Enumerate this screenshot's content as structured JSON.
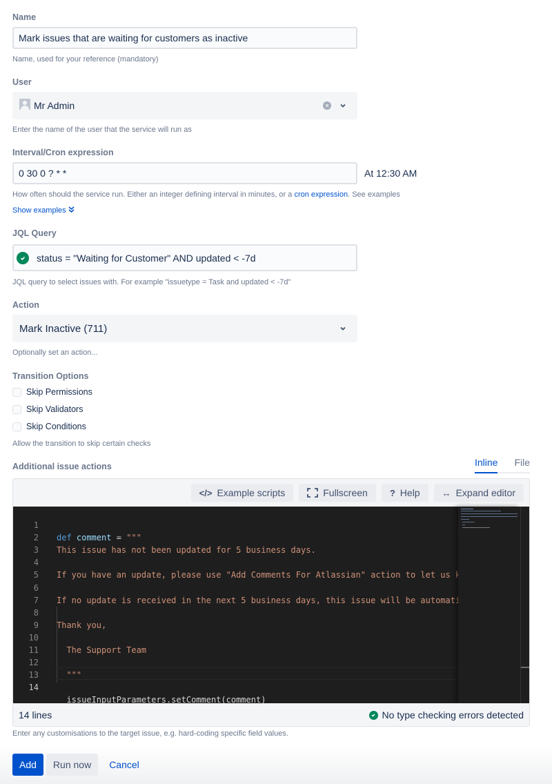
{
  "name": {
    "label": "Name",
    "value": "Mark issues that are waiting for customers as inactive",
    "helper": "Name, used for your reference (mandatory)"
  },
  "user": {
    "label": "User",
    "value": "Mr Admin",
    "helper": "Enter the name of the user that the service will run as"
  },
  "interval": {
    "label": "Interval/Cron expression",
    "value": "0 30 0 ? * *",
    "description": "At 12:30 AM",
    "helper_prefix": "How often should the service run. Either an integer defining interval in minutes, or a ",
    "helper_link": "cron expression",
    "helper_suffix": ". See examples",
    "show_examples": "Show examples"
  },
  "jql": {
    "label": "JQL Query",
    "value": "status = \"Waiting for Customer\" AND updated < -7d",
    "helper": "JQL query to select issues with. For example \"issuetype = Task and updated < -7d\""
  },
  "action": {
    "label": "Action",
    "value": "Mark Inactive (711)",
    "helper": "Optionally set an action..."
  },
  "transition": {
    "label": "Transition Options",
    "options": [
      {
        "label": "Skip Permissions",
        "checked": false
      },
      {
        "label": "Skip Validators",
        "checked": false
      },
      {
        "label": "Skip Conditions",
        "checked": false
      }
    ],
    "helper": "Allow the transition to skip certain checks"
  },
  "additional": {
    "label": "Additional issue actions",
    "tabs": [
      {
        "label": "Inline",
        "active": true
      },
      {
        "label": "File",
        "active": false
      }
    ],
    "toolbar": {
      "example_scripts": "Example scripts",
      "fullscreen": "Fullscreen",
      "help": "Help",
      "expand_editor": "Expand editor"
    },
    "code_lines": [
      {
        "num": "1",
        "text": "def comment = \"\"\""
      },
      {
        "num": "2",
        "text": "This issue has not been updated for 5 business days."
      },
      {
        "num": "3",
        "text": ""
      },
      {
        "num": "4",
        "text": "If you have an update, please use \"Add Comments For Atlassian\" action to let us k"
      },
      {
        "num": "5",
        "text": ""
      },
      {
        "num": "6",
        "text": "If no update is received in the next 5 business days, this issue will be automati"
      },
      {
        "num": "7",
        "text": ""
      },
      {
        "num": "8",
        "text": "Thank you,"
      },
      {
        "num": "9",
        "text": ""
      },
      {
        "num": "10",
        "text": "  The Support Team"
      },
      {
        "num": "11",
        "text": ""
      },
      {
        "num": "12",
        "text": "  \"\"\""
      },
      {
        "num": "13",
        "text": ""
      },
      {
        "num": "14",
        "text": "  issueInputParameters.setComment(comment)"
      }
    ],
    "line_count": "14 lines",
    "type_check": "No type checking errors detected",
    "helper": "Enter any customisations to the target issue, e.g. hard-coding specific field values."
  },
  "buttons": {
    "add": "Add",
    "run_now": "Run now",
    "cancel": "Cancel"
  }
}
